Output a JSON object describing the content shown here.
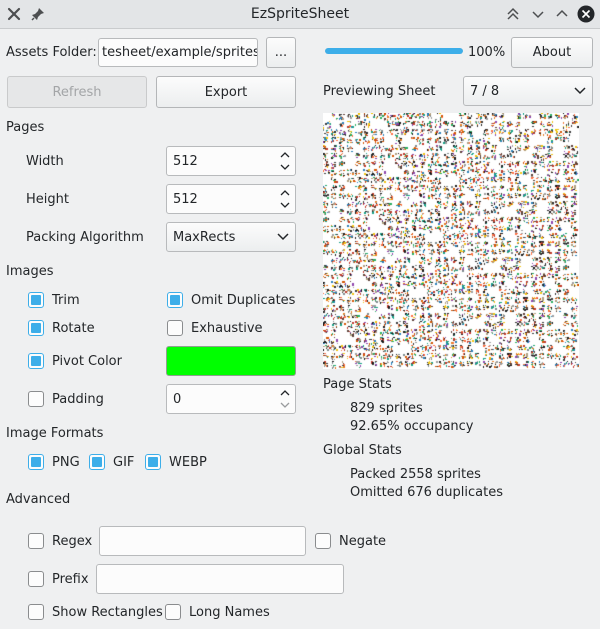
{
  "window": {
    "title": "EzSpriteSheet"
  },
  "assets": {
    "label": "Assets Folder:",
    "path": "tesheet/example/sprites",
    "browse_label": "..."
  },
  "progress": {
    "value_percent": 100,
    "text": "100%"
  },
  "buttons": {
    "about": "About",
    "refresh": "Refresh",
    "export": "Export"
  },
  "preview": {
    "label": "Previewing Sheet",
    "selected": "7 / 8"
  },
  "pages": {
    "heading": "Pages",
    "width_label": "Width",
    "width_value": "512",
    "height_label": "Height",
    "height_value": "512",
    "packing_label": "Packing Algorithm",
    "packing_value": "MaxRects"
  },
  "images": {
    "heading": "Images",
    "trim": {
      "label": "Trim",
      "checked": true
    },
    "omit_duplicates": {
      "label": "Omit Duplicates",
      "checked": true
    },
    "rotate": {
      "label": "Rotate",
      "checked": true
    },
    "exhaustive": {
      "label": "Exhaustive",
      "checked": false
    },
    "pivot_color": {
      "label": "Pivot Color",
      "checked": true,
      "color": "#00ff00"
    },
    "padding": {
      "label": "Padding",
      "checked": false,
      "value": "0"
    }
  },
  "formats": {
    "heading": "Image Formats",
    "png": {
      "label": "PNG",
      "checked": true
    },
    "gif": {
      "label": "GIF",
      "checked": true
    },
    "webp": {
      "label": "WEBP",
      "checked": true
    }
  },
  "page_stats": {
    "heading": "Page Stats",
    "sprites": "829 sprites",
    "occupancy": "92.65% occupancy"
  },
  "global_stats": {
    "heading": "Global Stats",
    "packed": "Packed 2558 sprites",
    "omitted": "Omitted 676 duplicates"
  },
  "advanced": {
    "heading": "Advanced",
    "regex": {
      "label": "Regex",
      "checked": false,
      "value": ""
    },
    "negate": {
      "label": "Negate",
      "checked": false
    },
    "prefix": {
      "label": "Prefix",
      "checked": false,
      "value": ""
    },
    "show_rectangles": {
      "label": "Show Rectangles",
      "checked": false
    },
    "long_names": {
      "label": "Long Names",
      "checked": false
    }
  },
  "colors": {
    "accent": "#3daee9",
    "window_bg": "#eff0f1"
  }
}
